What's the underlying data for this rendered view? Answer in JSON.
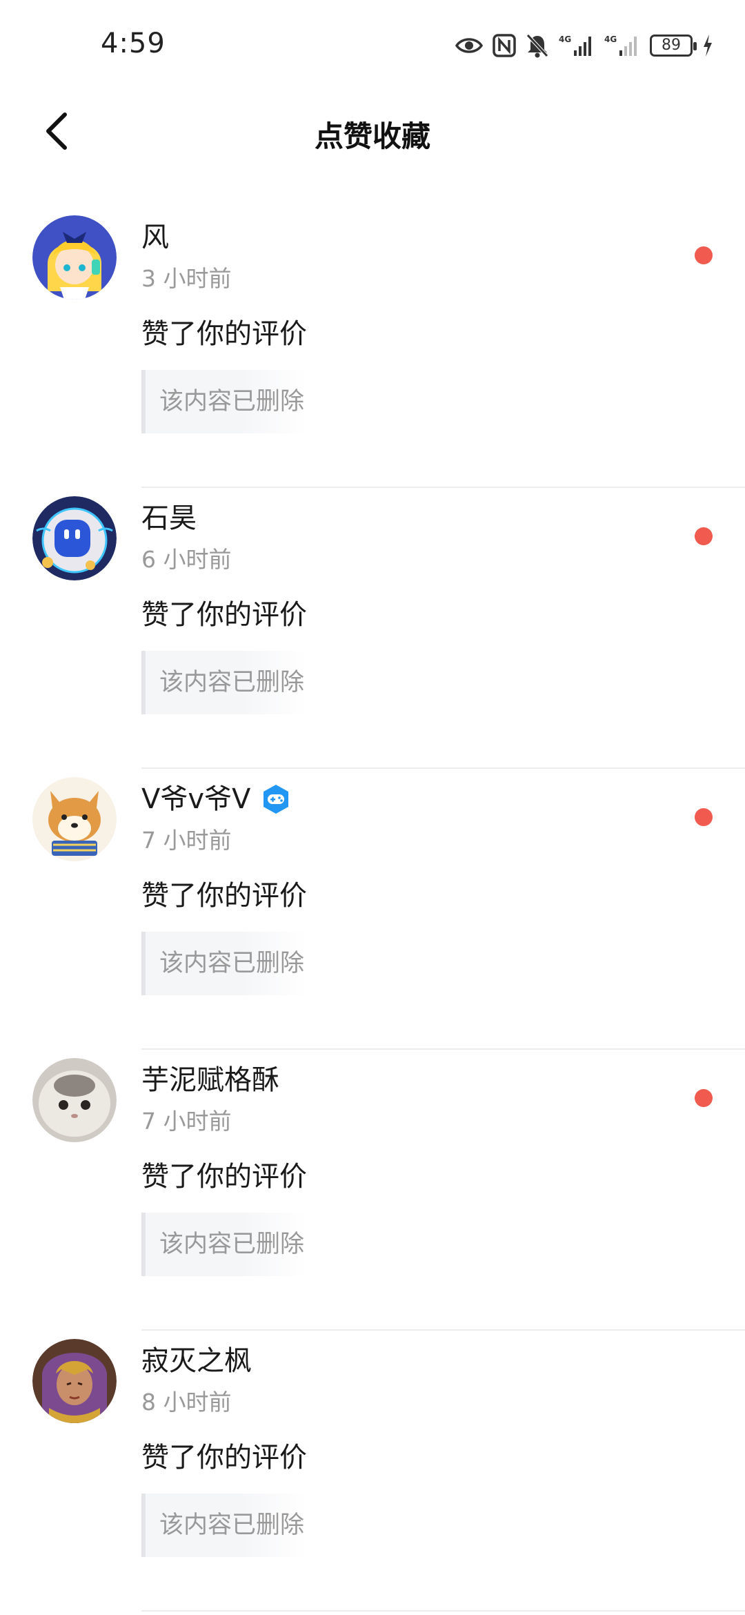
{
  "status_bar": {
    "time": "4:59",
    "battery": "89",
    "icons": [
      "eye-icon",
      "nfc-icon",
      "bell-off-icon",
      "signal-4g-icon",
      "signal-4g-icon",
      "battery-icon",
      "charging-icon"
    ]
  },
  "header": {
    "title": "点赞收藏",
    "back_icon": "chevron-left-icon"
  },
  "notifications": [
    {
      "name": "风",
      "time": "3 小时前",
      "action": "赞了你的评价",
      "quote": "该内容已删除",
      "unread": true,
      "verified": false
    },
    {
      "name": "石昊",
      "time": "6 小时前",
      "action": "赞了你的评价",
      "quote": "该内容已删除",
      "unread": true,
      "verified": false
    },
    {
      "name": "V爷v爷V",
      "time": "7 小时前",
      "action": "赞了你的评价",
      "quote": "该内容已删除",
      "unread": true,
      "verified": true
    },
    {
      "name": "芋泥赋格酥",
      "time": "7 小时前",
      "action": "赞了你的评价",
      "quote": "该内容已删除",
      "unread": true,
      "verified": false
    },
    {
      "name": "寂灭之枫",
      "time": "8 小时前",
      "action": "赞了你的评价",
      "quote": "该内容已删除",
      "unread": false,
      "verified": false
    }
  ],
  "colors": {
    "unread_dot": "#f05a4f",
    "badge": "#2196f3",
    "muted_text": "#999999"
  }
}
